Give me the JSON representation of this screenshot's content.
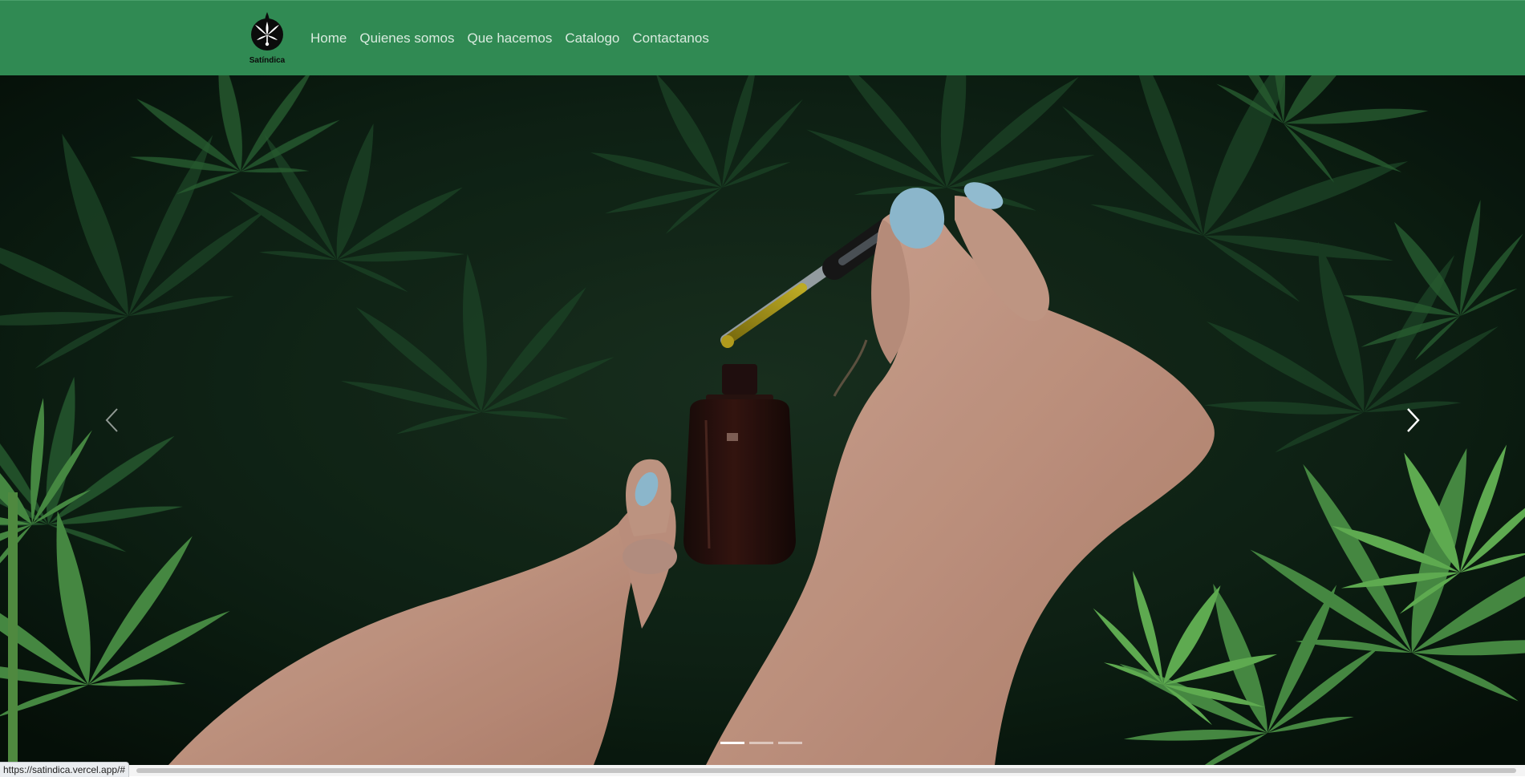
{
  "brand": {
    "name": "Satíndica",
    "logo_icon": "cannabis-leaf-icon"
  },
  "nav": {
    "items": [
      {
        "label": "Home"
      },
      {
        "label": "Quienes somos"
      },
      {
        "label": "Que hacemos"
      },
      {
        "label": "Catalogo"
      },
      {
        "label": "Contactanos"
      }
    ]
  },
  "carousel": {
    "slide_count": 3,
    "active_index": 0,
    "prev_icon": "chevron-left-icon",
    "next_icon": "chevron-right-icon"
  },
  "status": {
    "url": "https://satindica.vercel.app/#"
  },
  "colors": {
    "navbar": "#308a53",
    "nav_text": "#d9ebdf"
  }
}
